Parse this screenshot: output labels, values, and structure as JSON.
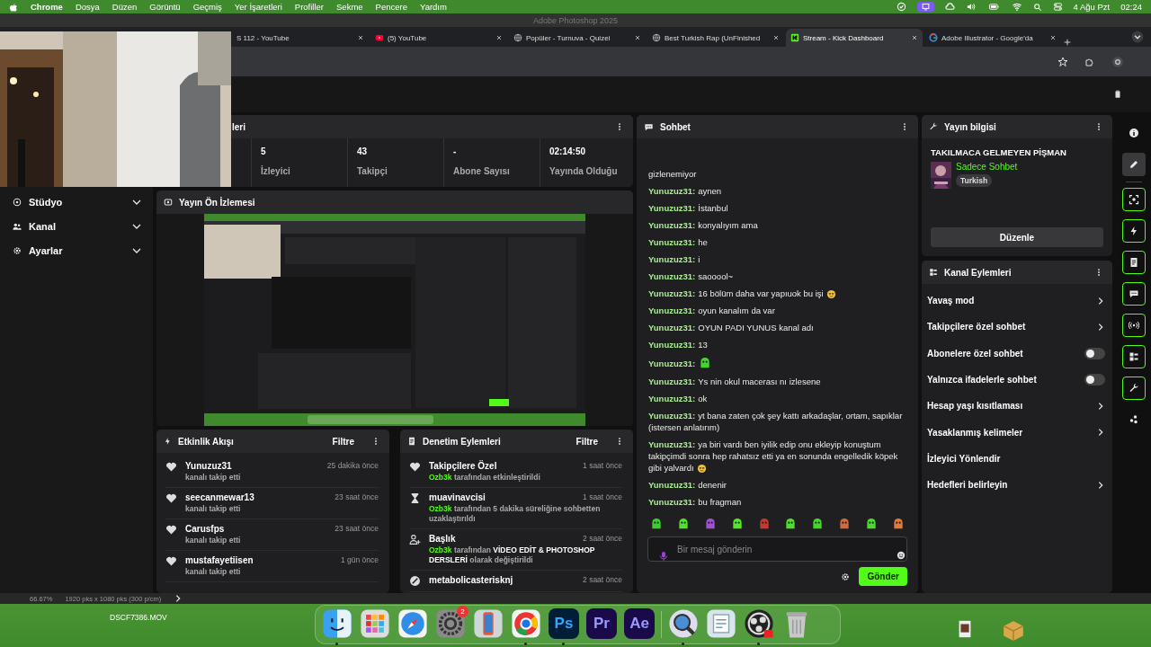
{
  "menu_bar": {
    "app": "Chrome",
    "menus": [
      "Dosya",
      "Düzen",
      "Görüntü",
      "Geçmiş",
      "Yer İşaretleri",
      "Profiller",
      "Sekme",
      "Pencere",
      "Yardım"
    ],
    "date": "4 Ağu Pzt",
    "time": "02:24"
  },
  "photoshop": {
    "title": "Adobe Photoshop 2025",
    "zoom": "66.67%",
    "doc_info": "1920 pks x 1080 pks (300 p/cm)"
  },
  "browser": {
    "tabs": [
      {
        "title": "S 112 - YouTube",
        "kind": "none",
        "selected": false
      },
      {
        "title": "(5) YouTube",
        "kind": "video",
        "selected": false
      },
      {
        "title": "Popüler - Turnuva - Quizei",
        "kind": "globe",
        "selected": false
      },
      {
        "title": "Best Turkish Rap (UnFinished",
        "kind": "globe",
        "selected": false
      },
      {
        "title": "Stream - Kick Dashboard",
        "kind": "kick",
        "selected": true
      },
      {
        "title": "Adobe Illustrator - Google'da",
        "kind": "search",
        "selected": false
      }
    ]
  },
  "sidebar": {
    "items": [
      {
        "label": "Stüdyo",
        "expanded": false
      },
      {
        "label": "Kanal",
        "expanded": false
      },
      {
        "label": "Ayarlar",
        "expanded": false
      }
    ]
  },
  "stats": {
    "title": "leri",
    "items": [
      {
        "value": "5",
        "label": "İzleyici"
      },
      {
        "value": "43",
        "label": "Takipçi"
      },
      {
        "value": "-",
        "label": "Abone Sayısı"
      },
      {
        "value": "02:14:50",
        "label": "Yayında Olduğu"
      }
    ]
  },
  "preview": {
    "title": "Yayın Ön İzlemesi"
  },
  "activity": {
    "title": "Etkinlik Akışı",
    "filter": "Filtre",
    "events": [
      {
        "user": "Yunuzuz31",
        "action": "kanalı takip etti",
        "time": "25 dakika önce"
      },
      {
        "user": "seecanmewar13",
        "action": "kanalı takip etti",
        "time": "23 saat önce"
      },
      {
        "user": "Carusfps",
        "action": "kanalı takip etti",
        "time": "23 saat önce"
      },
      {
        "user": "mustafayetiisen",
        "action": "kanalı takip etti",
        "time": "1 gün önce"
      }
    ]
  },
  "moderation": {
    "title": "Denetim Eylemleri",
    "filter": "Filtre",
    "actions": [
      {
        "kind": "follower_only",
        "title": "Takipçilere Özel",
        "time": "1 saat önce",
        "detail": "**Ozb3k** tarafından etkinleştirildi"
      },
      {
        "kind": "timeout",
        "title": "muavinavcisi",
        "time": "1 saat önce",
        "detail": "**Ozb3k** tarafından 5 dakika süreliğine sohbetten uzaklaştırıldı"
      },
      {
        "kind": "title",
        "title": "Başlık",
        "time": "2 saat önce",
        "detail": "**Ozb3k** tarafından **VİDEO EDİT & PHOTOSHOP DERSLERİ** olarak değiştirildi"
      },
      {
        "kind": "ban",
        "title": "metabolicasterisknj",
        "time": "2 saat önce"
      }
    ]
  },
  "chat": {
    "title": "Sohbet",
    "messages": [
      {
        "kind": "continuation",
        "text": "gizlenemiyor"
      },
      {
        "kind": "text",
        "user": "Yunuzuz31:",
        "text": "aynen"
      },
      {
        "kind": "text",
        "user": "Yunuzuz31:",
        "text": "İstanbul"
      },
      {
        "kind": "text",
        "user": "Yunuzuz31:",
        "text": "konyalıyım ama"
      },
      {
        "kind": "text",
        "user": "Yunuzuz31:",
        "text": "he"
      },
      {
        "kind": "text",
        "user": "Yunuzuz31:",
        "text": "i"
      },
      {
        "kind": "text",
        "user": "Yunuzuz31:",
        "text": "saooool~"
      },
      {
        "kind": "text",
        "user": "Yunuzuz31:",
        "text": "16 bölüm daha var yapıuok bu işi",
        "emoji": true
      },
      {
        "kind": "text",
        "user": "Yunuzuz31:",
        "text": "oyun kanalım da var"
      },
      {
        "kind": "text",
        "user": "Yunuzuz31:",
        "text": "OYUN PADI YUNUS kanal adı"
      },
      {
        "kind": "text",
        "user": "Yunuzuz31:",
        "text": "13"
      },
      {
        "kind": "emote",
        "user": "Yunuzuz31:"
      },
      {
        "kind": "text",
        "user": "Yunuzuz31:",
        "text": "Ys nin okul macerası nı izlesene"
      },
      {
        "kind": "text",
        "user": "Yunuzuz31:",
        "text": "ok"
      },
      {
        "kind": "text",
        "user": "Yunuzuz31:",
        "text": "yt bana zaten çok şey kattı arkadaşlar, ortam, sapıklar (istersen anlatırım)"
      },
      {
        "kind": "text",
        "user": "Yunuzuz31:",
        "text": "ya biri vardı ben iyilik edip onu ekleyip konuştum takipçimdi sonra hep rahatsız etti ya en sonunda engelledik köpek gibi yalvardı",
        "emoji": true
      },
      {
        "kind": "text",
        "user": "Yunuzuz31:",
        "text": "denenir"
      },
      {
        "kind": "text",
        "user": "Yunuzuz31:",
        "text": "bu fragman"
      }
    ],
    "placeholder": "Bir mesaj gönderin",
    "send": "Gönder"
  },
  "stream_info": {
    "title": "Yayın bilgisi",
    "stream_title": "TAKILMACA GELMEYEN PİŞMAN",
    "category": "Sadece Sohbet",
    "tags": [
      "Turkish"
    ],
    "edit": "Düzenle"
  },
  "channel_actions": {
    "title": "Kanal Eylemleri",
    "items": [
      {
        "kind": "link",
        "label": "Yavaş mod"
      },
      {
        "kind": "link",
        "label": "Takipçilere özel sohbet"
      },
      {
        "kind": "toggle",
        "label": "Abonelere özel sohbet",
        "on": false
      },
      {
        "kind": "toggle",
        "label": "Yalnızca ifadelerle sohbet",
        "on": false
      },
      {
        "kind": "link",
        "label": "Hesap yaşı kısıtlaması"
      },
      {
        "kind": "link",
        "label": "Yasaklanmış kelimeler"
      },
      {
        "kind": "plain",
        "label": "İzleyici Yönlendir"
      },
      {
        "kind": "link",
        "label": "Hedefleri belirleyin"
      }
    ]
  },
  "rail": [
    {
      "selected": false,
      "outlined": false
    },
    {
      "selected": true,
      "outlined": false
    },
    {
      "selected": false,
      "outlined": true
    },
    {
      "selected": false,
      "outlined": true
    },
    {
      "selected": false,
      "outlined": true
    },
    {
      "selected": false,
      "outlined": true
    },
    {
      "selected": false,
      "outlined": true
    },
    {
      "selected": false,
      "outlined": true
    },
    {
      "selected": false,
      "outlined": true
    },
    {
      "selected": false,
      "outlined": false
    }
  ],
  "desktop": {
    "files": [
      "DSCF7386.MOV"
    ]
  },
  "dock": {
    "items": [
      {
        "running": true
      },
      {
        "running": false
      },
      {
        "running": false
      },
      {
        "running": false,
        "badge": "2"
      },
      {
        "running": false
      },
      {
        "running": true
      },
      {
        "running": true,
        "label": "Ps"
      },
      {
        "running": false,
        "label": "Pr"
      },
      {
        "running": false,
        "label": "Ae"
      },
      {
        "running": true
      },
      {
        "running": false
      },
      {
        "running": true
      },
      {
        "running": false
      }
    ]
  }
}
